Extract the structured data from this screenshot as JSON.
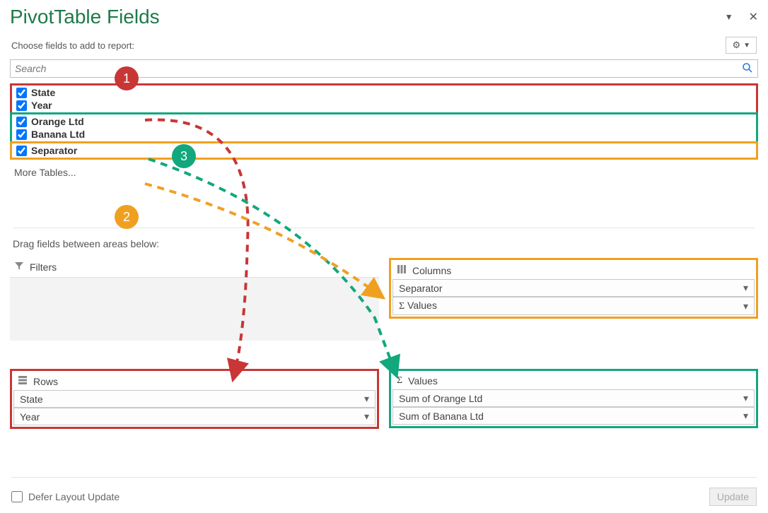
{
  "header": {
    "title": "PivotTable Fields",
    "subtitle": "Choose fields to add to report:"
  },
  "search": {
    "placeholder": "Search"
  },
  "field_groups": [
    {
      "border": "group1",
      "items": [
        "State",
        "Year"
      ]
    },
    {
      "border": "group2",
      "items": [
        "Orange Ltd",
        "Banana Ltd"
      ]
    },
    {
      "border": "group3",
      "items": [
        "Separator"
      ]
    }
  ],
  "more_tables": "More Tables...",
  "mid_label": "Drag fields between areas below:",
  "areas": {
    "filters": {
      "label": "Filters"
    },
    "columns": {
      "label": "Columns",
      "items": [
        "Separator",
        "Σ Values"
      ]
    },
    "rows": {
      "label": "Rows",
      "items": [
        "State",
        "Year"
      ]
    },
    "values": {
      "label": "Values",
      "items": [
        "Sum of Orange Ltd",
        "Sum of Banana Ltd"
      ]
    }
  },
  "defer": {
    "label": "Defer Layout Update",
    "button": "Update"
  },
  "badges": {
    "b1": "1",
    "b2": "2",
    "b3": "3"
  },
  "colors": {
    "red": "#c83636",
    "green": "#12a77d",
    "orange": "#f0a020"
  }
}
